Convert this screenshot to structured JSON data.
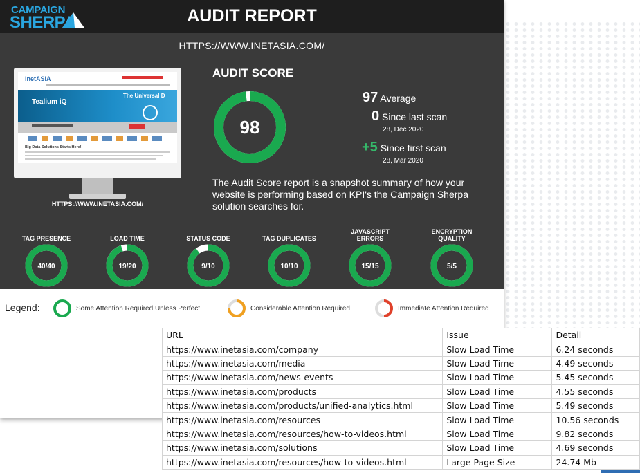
{
  "header": {
    "logo_top": "CAMPAIGN",
    "logo_bottom": "SHERPA",
    "title": "AUDIT REPORT"
  },
  "site_url": "HTTPS://WWW.INETASIA.COM/",
  "monitor": {
    "caption": "HTTPS://WWW.INETASIA.COM/",
    "screen": {
      "brand": "inetASIA",
      "hero_left": "Tealium iQ",
      "hero_right": "The Universal D",
      "section_title": "Big Data Solutions Starts Here!"
    }
  },
  "audit_score": {
    "title": "AUDIT SCORE",
    "score": "98",
    "score_fraction": 0.98,
    "average_value": "97",
    "average_label": "Average",
    "last_scan_value": "0",
    "last_scan_label": "Since last scan",
    "last_scan_date": "28, Dec 2020",
    "first_scan_value": "+5",
    "first_scan_label": "Since first scan",
    "first_scan_date": "28, Mar 2020",
    "description": "The Audit Score report is a snapshot summary of how your website is performing based on KPI's the Campaign Sherpa solution searches for."
  },
  "gauges": [
    {
      "label": "TAG PRESENCE",
      "value": "40/40",
      "fraction": 1.0
    },
    {
      "label": "LOAD TIME",
      "value": "19/20",
      "fraction": 0.95
    },
    {
      "label": "STATUS CODE",
      "value": "9/10",
      "fraction": 0.9
    },
    {
      "label": "TAG DUPLICATES",
      "value": "10/10",
      "fraction": 1.0
    },
    {
      "label": "JAVASCRIPT ERRORS",
      "value": "15/15",
      "fraction": 1.0
    },
    {
      "label": "ENCRYPTION QUALITY",
      "value": "5/5",
      "fraction": 1.0
    }
  ],
  "legend": {
    "label": "Legend:",
    "items": [
      {
        "text": "Some Attention Required Unless Perfect",
        "color": "#1aa94f"
      },
      {
        "text": "Considerable Attention Required",
        "color": "#f0a020"
      },
      {
        "text": "Immediate Attention Required",
        "color": "#e0402a"
      }
    ]
  },
  "colors": {
    "good": "#1aa94f",
    "track": "#ffffff",
    "header_bg": "#1e1e1e",
    "panel_bg": "#3a3a3a",
    "brand_blue": "#2aa6e0"
  },
  "table": {
    "columns": [
      "URL",
      "Issue",
      "Detail"
    ],
    "rows": [
      [
        "https://www.inetasia.com/company",
        "Slow Load Time",
        "6.24 seconds"
      ],
      [
        "https://www.inetasia.com/media",
        "Slow Load Time",
        "4.49 seconds"
      ],
      [
        "https://www.inetasia.com/news-events",
        "Slow Load Time",
        "5.45 seconds"
      ],
      [
        "https://www.inetasia.com/products",
        "Slow Load Time",
        "4.55 seconds"
      ],
      [
        "https://www.inetasia.com/products/unified-analytics.html",
        "Slow Load Time",
        "5.49 seconds"
      ],
      [
        "https://www.inetasia.com/resources",
        "Slow Load Time",
        "10.56 seconds"
      ],
      [
        "https://www.inetasia.com/resources/how-to-videos.html",
        "Slow Load Time",
        "9.82 seconds"
      ],
      [
        "https://www.inetasia.com/solutions",
        "Slow Load Time",
        "4.69 seconds"
      ],
      [
        "https://www.inetasia.com/resources/how-to-videos.html",
        "Large Page Size",
        "24.74 Mb"
      ]
    ]
  }
}
